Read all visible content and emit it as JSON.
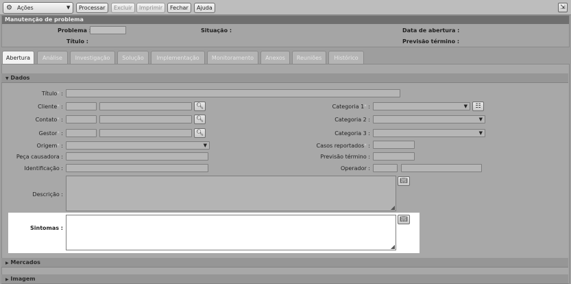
{
  "toolbar": {
    "acoes_label": "Ações",
    "processar": "Processar",
    "excluir": "Excluir",
    "imprimir": "Imprimir",
    "fechar": "Fechar",
    "ajuda": "Ajuda"
  },
  "header": {
    "title": "Manutenção de problema",
    "problema": "Problema :",
    "situacao": "Situação :",
    "data_abertura": "Data de abertura :",
    "titulo": "Título :",
    "previsao_termino": "Previsão término :"
  },
  "tabs": [
    "Abertura",
    "Análise",
    "Investigação",
    "Solução",
    "Implementação",
    "Monitoramento",
    "Anexos",
    "Reuniões",
    "Histórico"
  ],
  "sections": {
    "dados": "Dados",
    "mercados": "Mercados",
    "imagem": "Imagem"
  },
  "fields": {
    "titulo": "Título",
    "cliente": "Cliente",
    "contato": "Contato",
    "gestor": "Gestor",
    "origem": "Origem",
    "peca_causadora": "Peça causadora :",
    "identificacao": "Identificação :",
    "descricao": "Descrição :",
    "sintomas": "Sintomas :",
    "categoria1": "Categoria 1",
    "categoria2": "Categoria 2 :",
    "categoria3": "Categoria 3 :",
    "casos_reportados": "Casos reportados",
    "previsao_termino": "Previsão término :",
    "operador": "Operador :",
    "required_mark": "*",
    "colon": " :"
  },
  "icons": {
    "acoes": "gear-icon",
    "exit": "exit-icon",
    "search": "magnifier-icon",
    "book": "book-icon",
    "list": "list-icon",
    "expand": "triangle-icon"
  }
}
